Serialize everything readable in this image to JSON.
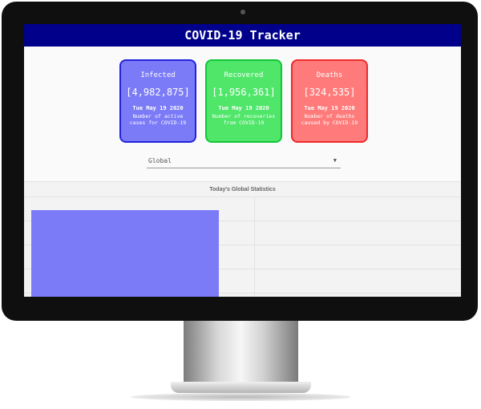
{
  "app": {
    "title": "COVID-19 Tracker"
  },
  "cards": [
    {
      "title": "Infected",
      "count": "[4,982,875]",
      "date": "Tue May 19 2020",
      "description": "Number of active cases for COVID-19"
    },
    {
      "title": "Recovered",
      "count": "[1,956,361]",
      "date": "Tue May 19 2020",
      "description": "Number of recoveries from COVID-19"
    },
    {
      "title": "Deaths",
      "count": "[324,535]",
      "date": "Tue May 19 2020",
      "description": "Number of deaths caused by COVID-19"
    }
  ],
  "country_select": {
    "selected": "Global"
  },
  "chart": {
    "title": "Today's Global Statistics"
  },
  "colors": {
    "navbar": "#00008b",
    "infected_bg": "#7b7bf7",
    "infected_border": "#2222dd",
    "recovered_bg": "#4fe66a",
    "recovered_border": "#12c537",
    "deaths_bg": "#ff7b7b",
    "deaths_border": "#ee2a2a",
    "bar": "#7b7bf7"
  }
}
